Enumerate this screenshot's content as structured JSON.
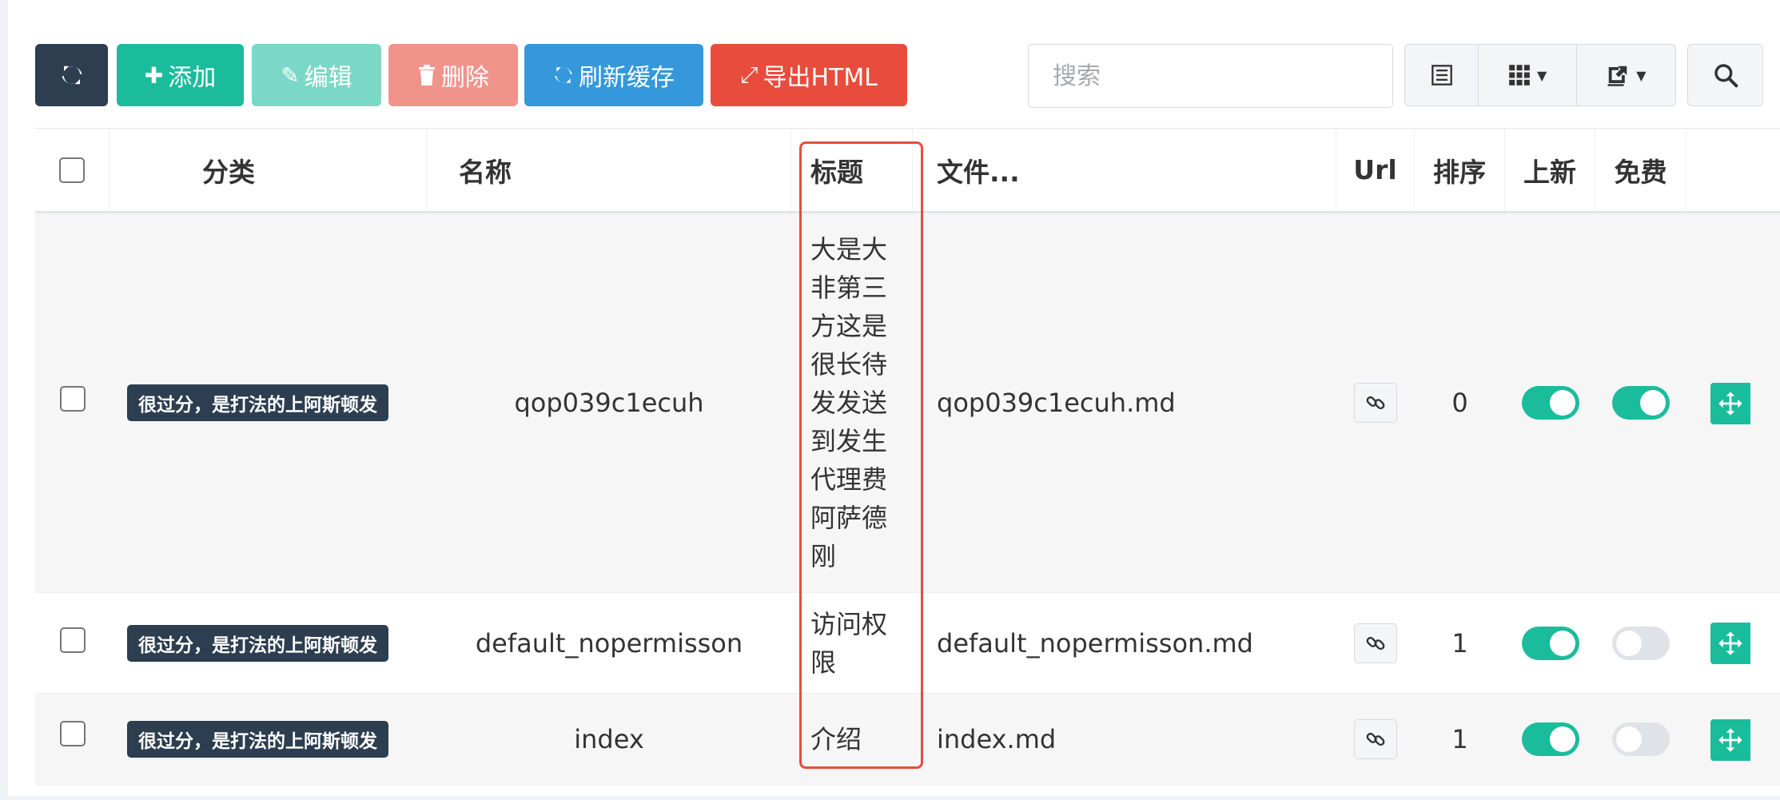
{
  "toolbar": {
    "refresh_label": "",
    "add_label": "添加",
    "edit_label": "编辑",
    "delete_label": "删除",
    "refresh_cache_label": "刷新缓存",
    "export_html_label": "导出HTML",
    "search_placeholder": "搜索"
  },
  "table": {
    "headers": {
      "category": "分类",
      "name": "名称",
      "title": "标题",
      "file": "文件...",
      "url": "Url",
      "order": "排序",
      "is_new": "上新",
      "free": "免费"
    },
    "rows": [
      {
        "category": "很过分，是打法的上阿斯顿发",
        "name": "qop039c1ecuh",
        "title": "大是大非第三方这是很长待发发送到发生代理费阿萨德刚",
        "file": "qop039c1ecuh.md",
        "order": "0",
        "is_new": true,
        "free": true
      },
      {
        "category": "很过分，是打法的上阿斯顿发",
        "name": "default_nopermisson",
        "title": "访问权限",
        "file": "default_nopermisson.md",
        "order": "1",
        "is_new": true,
        "free": false
      },
      {
        "category": "很过分，是打法的上阿斯顿发",
        "name": "index",
        "title": "介绍",
        "file": "index.md",
        "order": "1",
        "is_new": true,
        "free": false
      }
    ]
  },
  "colors": {
    "primary_dark": "#2c3e50",
    "success": "#1abc9c",
    "info": "#3498db",
    "danger": "#e74c3c",
    "highlight_border": "#e74c3c"
  }
}
